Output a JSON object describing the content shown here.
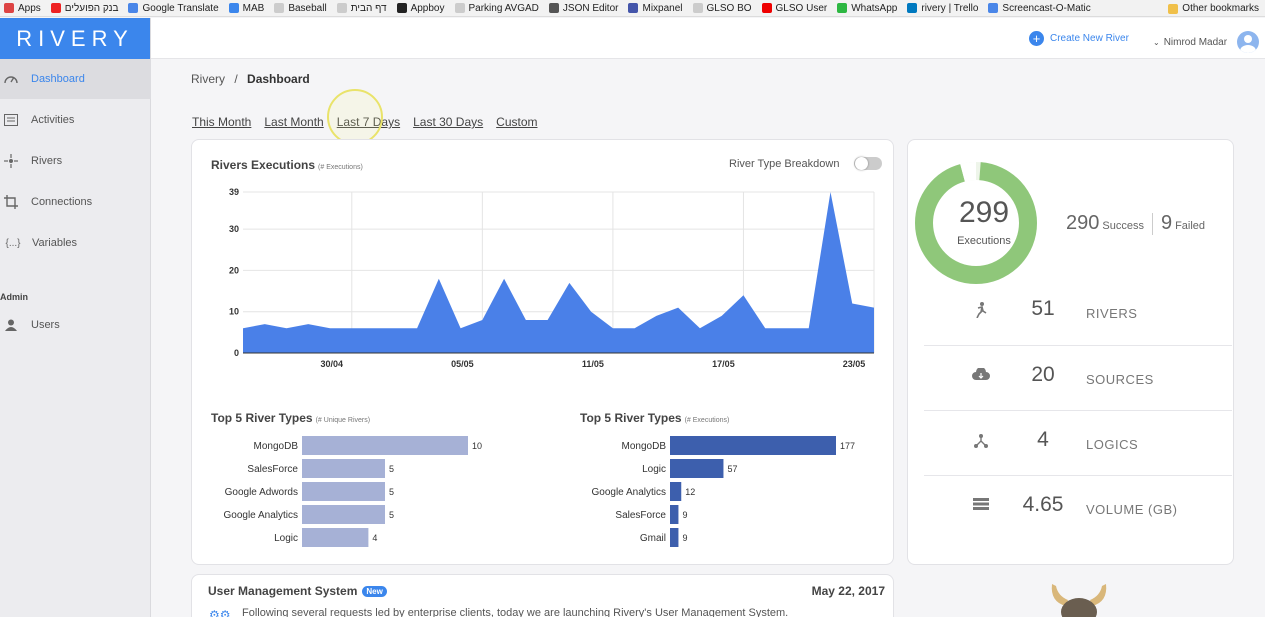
{
  "bookmarks": [
    {
      "label": "Apps",
      "icon": "apps-grid-icon",
      "color": "#d44"
    },
    {
      "label": "בנק הפועלים",
      "icon": "bank-icon",
      "color": "#e22"
    },
    {
      "label": "Google Translate",
      "icon": "translate-icon",
      "color": "#4a86e8"
    },
    {
      "label": "MAB",
      "icon": "mab-icon",
      "color": "#3b86ec"
    },
    {
      "label": "Baseball",
      "icon": "page-icon",
      "color": "#ccc"
    },
    {
      "label": "דף הבית",
      "icon": "page-icon",
      "color": "#ccc"
    },
    {
      "label": "Appboy",
      "icon": "appboy-icon",
      "color": "#222"
    },
    {
      "label": "Parking AVGAD",
      "icon": "page-icon",
      "color": "#ccc"
    },
    {
      "label": "JSON Editor",
      "icon": "json-icon",
      "color": "#555"
    },
    {
      "label": "Mixpanel",
      "icon": "mixpanel-icon",
      "color": "#4455aa"
    },
    {
      "label": "GLSO BO",
      "icon": "page-icon",
      "color": "#ccc"
    },
    {
      "label": "GLSO User",
      "icon": "youtube-icon",
      "color": "#e00"
    },
    {
      "label": "WhatsApp",
      "icon": "whatsapp-icon",
      "color": "#2db742"
    },
    {
      "label": "rivery | Trello",
      "icon": "trello-icon",
      "color": "#0079bf"
    },
    {
      "label": "Screencast-O-Matic",
      "icon": "screencast-icon",
      "color": "#4a86e8"
    }
  ],
  "bookmarks_other": "Other bookmarks",
  "brand": {
    "logo": "RIVERY",
    "accent": "#3b86ec"
  },
  "sidebar": {
    "items": [
      {
        "label": "Dashboard",
        "icon": "dashboard-gauge-icon",
        "active": true
      },
      {
        "label": "Activities",
        "icon": "activities-list-icon"
      },
      {
        "label": "Rivers",
        "icon": "rivers-icon"
      },
      {
        "label": "Connections",
        "icon": "connections-crop-icon"
      },
      {
        "label": "Variables",
        "icon": "variables-braces-icon"
      }
    ],
    "admin_label": "Admin",
    "admin_items": [
      {
        "label": "Users",
        "icon": "user-icon"
      }
    ]
  },
  "topbar": {
    "create_label": "Create New River",
    "user_name": "Nimrod Madar"
  },
  "breadcrumb": {
    "root": "Rivery",
    "sep": "/",
    "current": "Dashboard"
  },
  "ranges": [
    "This Month",
    "Last Month",
    "Last 7 Days",
    "Last 30 Days",
    "Custom"
  ],
  "executions": {
    "title": "Rivers Executions",
    "subtitle": "(# Executions)",
    "toggle_label": "River Type Breakdown"
  },
  "top_types_rivers": {
    "title": "Top 5 River Types",
    "subtitle": "(# Unique Rivers)"
  },
  "top_types_exec": {
    "title": "Top 5 River Types",
    "subtitle": "(# Executions)"
  },
  "stats": {
    "executions_total": "299",
    "executions_label": "Executions",
    "success_value": "290",
    "success_label": "Success",
    "failed_value": "9",
    "failed_label": "Failed",
    "rows": [
      {
        "value": "51",
        "label": "RIVERS",
        "icon": "runner-icon"
      },
      {
        "value": "20",
        "label": "SOURCES",
        "icon": "cloud-download-icon"
      },
      {
        "value": "4",
        "label": "LOGICS",
        "icon": "logic-fork-icon"
      },
      {
        "value": "4.65",
        "label": "VOLUME (GB)",
        "icon": "volume-list-icon"
      }
    ]
  },
  "news": {
    "title": "User Management System",
    "badge": "New",
    "date": "May 22, 2017",
    "body": "Following several requests led by enterprise clients, today we are launching Rivery's User Management System."
  },
  "chart_data": [
    {
      "type": "area",
      "title": "Rivers Executions",
      "subtitle": "(# Executions)",
      "x_ticks": [
        "30/04",
        "05/05",
        "11/05",
        "17/05",
        "23/05"
      ],
      "y_ticks": [
        0,
        10,
        20,
        30,
        39
      ],
      "ylim": [
        0,
        39
      ],
      "color": "#4a80e8",
      "values": [
        6,
        7,
        6,
        7,
        6,
        6,
        6,
        6,
        6,
        18,
        6,
        8,
        18,
        8,
        8,
        17,
        10,
        6,
        6,
        9,
        11,
        6,
        9,
        14,
        6,
        6,
        6,
        39,
        12,
        11
      ],
      "x_tick_index": [
        5,
        11,
        17,
        23,
        29
      ]
    },
    {
      "type": "bar",
      "orientation": "horizontal",
      "title": "Top 5 River Types",
      "subtitle": "(# Unique Rivers)",
      "categories": [
        "MongoDB",
        "SalesForce",
        "Google Adwords",
        "Google Analytics",
        "Logic"
      ],
      "values": [
        10,
        5,
        5,
        5,
        4
      ],
      "max": 10,
      "color": "#a6b1d6"
    },
    {
      "type": "bar",
      "orientation": "horizontal",
      "title": "Top 5 River Types",
      "subtitle": "(# Executions)",
      "categories": [
        "MongoDB",
        "Logic",
        "Google Analytics",
        "SalesForce",
        "Gmail"
      ],
      "values": [
        177,
        57,
        12,
        9,
        9
      ],
      "max": 177,
      "color": "#3d5fad"
    },
    {
      "type": "pie",
      "title": "",
      "values": [
        290,
        9
      ],
      "labels": [
        "Success",
        "Failed"
      ],
      "colors": [
        "#8fc77a",
        "#ffffff"
      ]
    }
  ]
}
